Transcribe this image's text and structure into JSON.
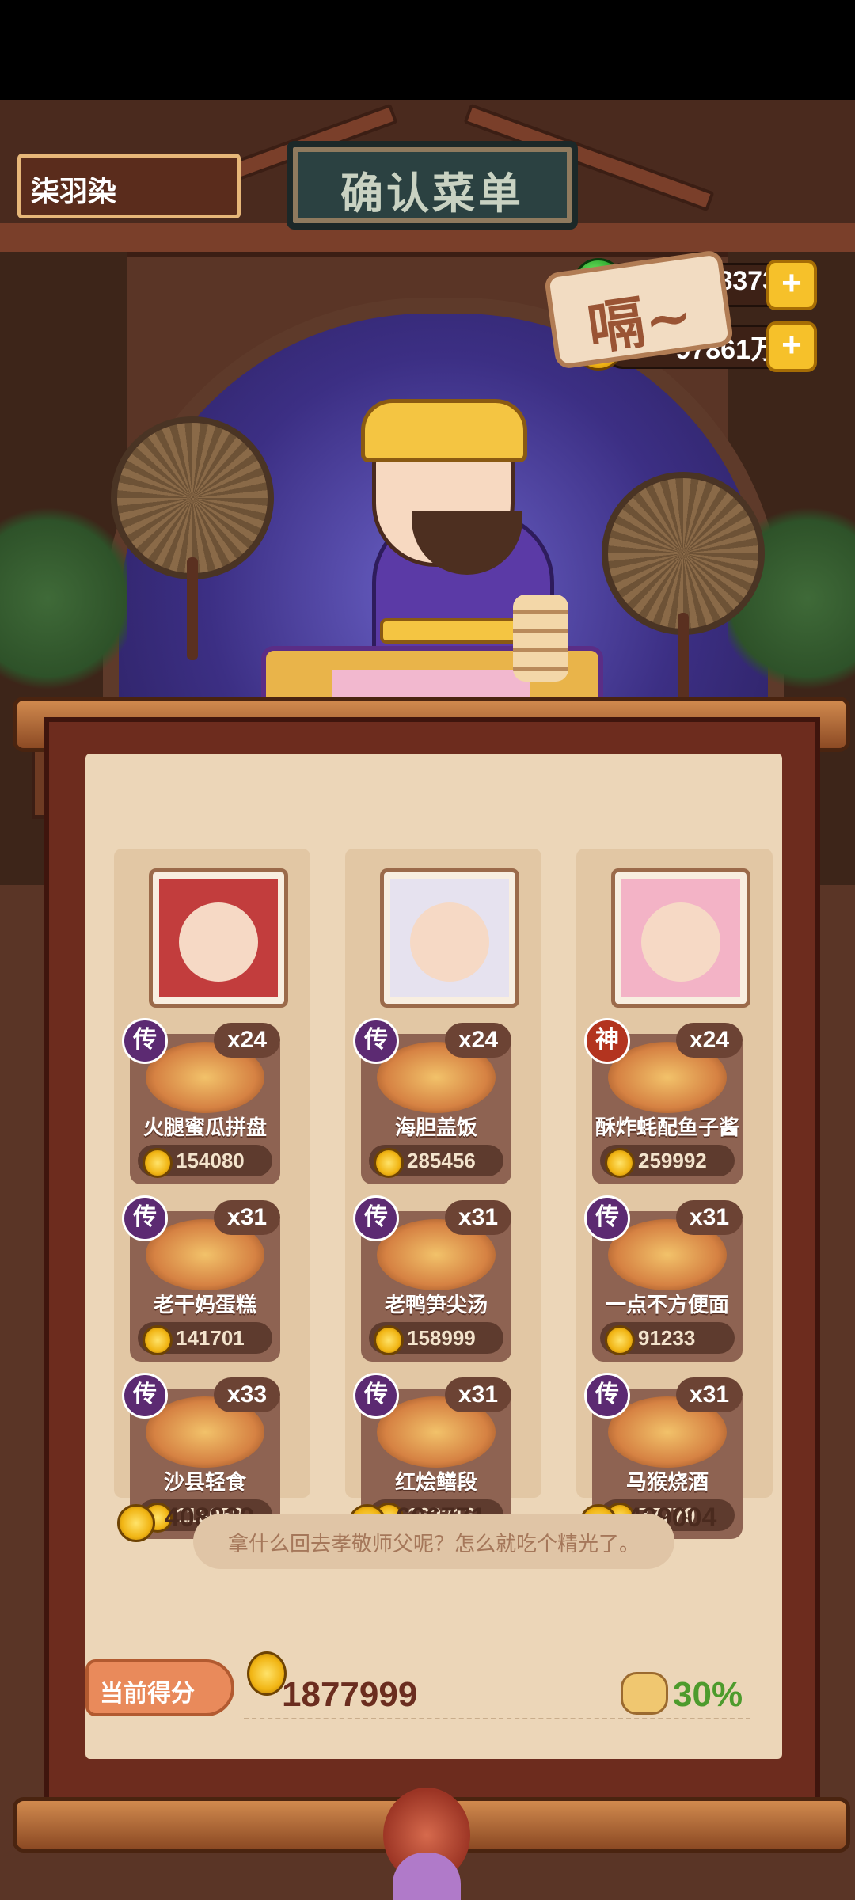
{
  "player": {
    "name": "柒羽染"
  },
  "sign": {
    "title": "确认菜单"
  },
  "currency": [
    {
      "icon": "jade-icon",
      "value": "78373"
    },
    {
      "icon": "coin-icon",
      "value": "97861万"
    }
  ],
  "speech": {
    "text": "嗝~"
  },
  "columns": [
    {
      "portrait": "chef-portrait-warrior",
      "dishes": [
        {
          "badge": "传",
          "count": "x24",
          "name": "火腿蜜瓜拼盘",
          "price": "154080"
        },
        {
          "badge": "传",
          "count": "x31",
          "name": "老干妈蛋糕",
          "price": "141701"
        },
        {
          "badge": "传",
          "count": "x33",
          "name": "沙县轻食",
          "price": "113058"
        }
      ],
      "total": "408839"
    },
    {
      "portrait": "chef-portrait-lion-dancer",
      "dishes": [
        {
          "badge": "传",
          "count": "x24",
          "name": "海胆盖饭",
          "price": "285456"
        },
        {
          "badge": "传",
          "count": "x31",
          "name": "老鸭笋尖汤",
          "price": "158999"
        },
        {
          "badge": "传",
          "count": "x31",
          "name": "红烩鳝段",
          "price": "162316"
        }
      ],
      "total": "606771"
    },
    {
      "portrait": "chef-portrait-pink-girl",
      "dishes": [
        {
          "badge": "神",
          "count": "x24",
          "name": "酥炸蚝配鱼子酱",
          "price": "259992"
        },
        {
          "badge": "传",
          "count": "x31",
          "name": "一点不方便面",
          "price": "91233"
        },
        {
          "badge": "传",
          "count": "x31",
          "name": "马猴烧酒",
          "price": "77779"
        }
      ],
      "total": "429004"
    }
  ],
  "quote": "拿什么回去孝敬师父呢？怎么就吃个精光了。",
  "score": {
    "label": "当前得分",
    "value": "1877999",
    "bonus": "30%"
  },
  "colors": {
    "legend_badge": "#5c2a72",
    "god_badge": "#b3341f",
    "bonus_green": "#4d9b2c",
    "coin_gold": "#f1b514"
  }
}
